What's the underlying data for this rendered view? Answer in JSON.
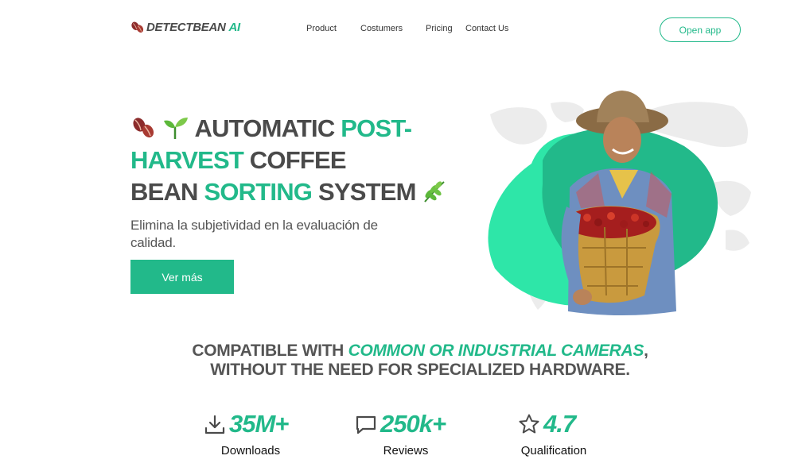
{
  "brand": {
    "name": "DETECTBEAN",
    "suffix": "AI"
  },
  "nav": {
    "items": [
      {
        "label": "Product"
      },
      {
        "label": "Costumers"
      },
      {
        "label": "Pricing"
      },
      {
        "label": "Contact Us"
      }
    ],
    "open_app": "Open app"
  },
  "hero": {
    "title": {
      "w1": "AUTOMATIC",
      "w2": "POST-",
      "w3": "HARVEST",
      "w4": "COFFEE",
      "w5": "BEAN",
      "w6": "SORTING",
      "w7": "SYSTEM"
    },
    "subtitle": "Elimina la subjetividad en la evaluación de calidad.",
    "cta": "Ver más"
  },
  "compat": {
    "t1": "COMPATIBLE WITH",
    "t2": "COMMON OR INDUSTRIAL CAMERAS",
    "t3": ", WITHOUT THE NEED FOR SPECIALIZED HARDWARE."
  },
  "stats": [
    {
      "value": "35M+",
      "label": "Downloads",
      "icon": "download-icon"
    },
    {
      "value": "250k+",
      "label": "Reviews",
      "icon": "chat-icon"
    },
    {
      "value": "4.7",
      "label": "Qualification",
      "icon": "star-icon"
    }
  ],
  "colors": {
    "accent": "#22b98a",
    "blob_light": "#2ee6a8",
    "text_dark": "#4a4a4a"
  }
}
